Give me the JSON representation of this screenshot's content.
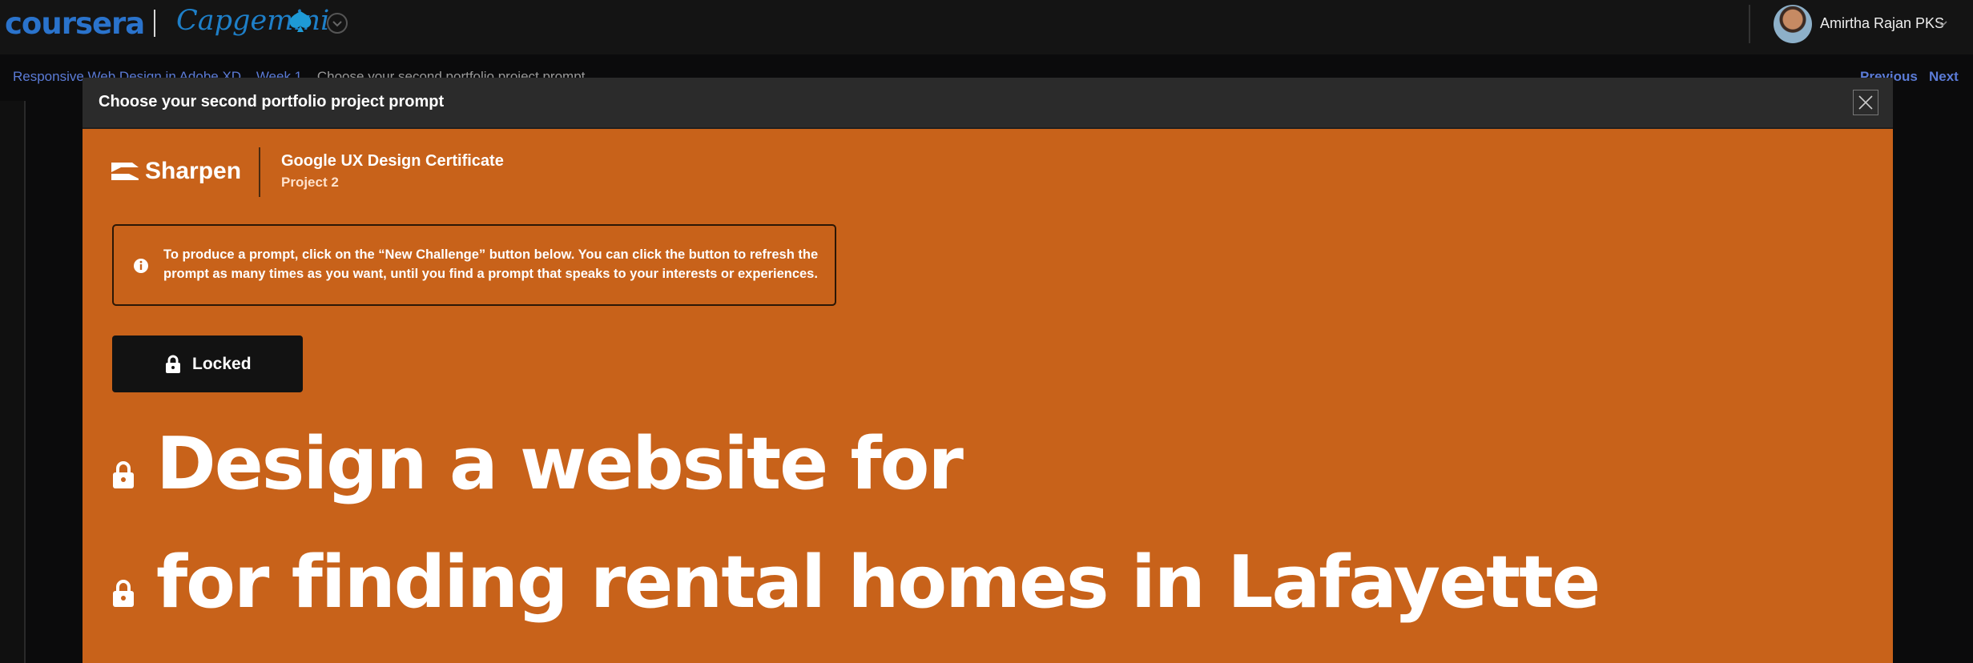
{
  "topbar": {
    "coursera_logo": "coursera",
    "partner_logo": "Capgemini",
    "user_name": "Amirtha Rajan PKS"
  },
  "breadcrumb": {
    "items": [
      "Responsive Web Design in Adobe XD",
      "Week 1",
      "Choose your second portfolio project prompt"
    ],
    "previous": "Previous",
    "next": "Next"
  },
  "modal": {
    "title": "Choose your second portfolio project prompt",
    "brand": "Sharpen",
    "certificate": "Google UX Design Certificate",
    "project": "Project 2",
    "info_text": "To produce a prompt, click on the “New Challenge” button below. You can click the button to refresh the prompt as many times as you want, until you find a prompt that speaks to your interests or experiences.",
    "locked_label": "Locked",
    "prompt_line_1": "Design a website for",
    "prompt_line_2": "for finding rental homes in Lafayette"
  },
  "colors": {
    "modal_bg": "#c8621a",
    "coursera_blue": "#2a73cc",
    "link_blue": "#5b7bd6"
  }
}
